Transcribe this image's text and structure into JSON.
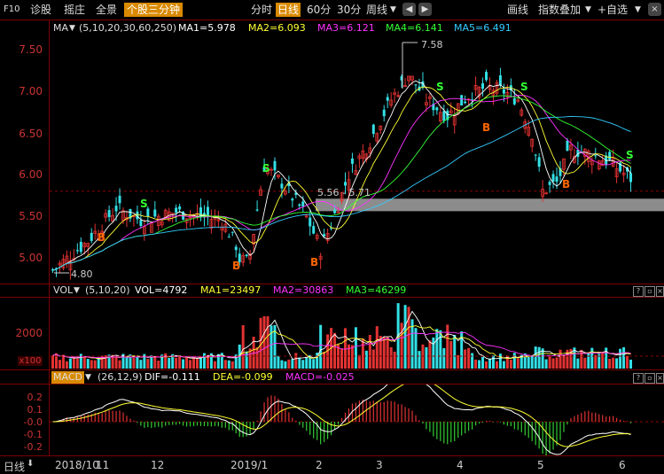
{
  "toolbar": {
    "f10": "F10",
    "diagnose": "诊股",
    "hot": "摇庄",
    "panorama": "全景",
    "tab_three_min": "个股三分钟",
    "periods": [
      "分时",
      "日线",
      "60分",
      "30分",
      "周线"
    ],
    "active_period": "日线",
    "draw_line": "画线",
    "index_overlay": "指数叠加",
    "add_watchlist": "+自选"
  },
  "ma_bar": {
    "name": "MA",
    "params": "(5,10,20,30,60,250)",
    "ma1": "MA1=5.978",
    "ma2": "MA2=6.093",
    "ma3": "MA3=6.121",
    "ma4": "MA4=6.141",
    "ma5": "MA5=6.491"
  },
  "vol_bar": {
    "name": "VOL",
    "params": "(5,10,20)",
    "vol": "VOL=4792",
    "ma1": "MA1=23497",
    "ma2": "MA2=30863",
    "ma3": "MA3=46299"
  },
  "macd_bar": {
    "name": "MACD",
    "params": "(26,12,9)",
    "dif": "DIF=-0.111",
    "dea": "DEA=-0.099",
    "macd": "MACD=-0.025"
  },
  "price_axis": [
    "7.50",
    "7.00",
    "6.50",
    "6.00",
    "5.50",
    "5.00"
  ],
  "vol_axis": [
    "2000",
    "x100"
  ],
  "macd_axis": [
    "0.2",
    "0.1",
    "-0.0",
    "-0.1",
    "-0.2"
  ],
  "annotations": {
    "high": "7.58",
    "low": "4.80",
    "range_label": "5.56 - 5.71",
    "signal_s": "S",
    "signal_b": "B"
  },
  "date_axis": {
    "period_label": "日线",
    "ticks": [
      "2018/10",
      "11",
      "12",
      "2019/1",
      "2",
      "3",
      "4",
      "5",
      "6"
    ]
  },
  "colors": {
    "up": "#e23232",
    "down": "#33e0e6",
    "ma1": "#ffffff",
    "ma2": "#ffff33",
    "ma3": "#ff33ff",
    "ma4": "#33ff33",
    "ma5": "#33ccff",
    "accent": "#d98a00"
  }
}
